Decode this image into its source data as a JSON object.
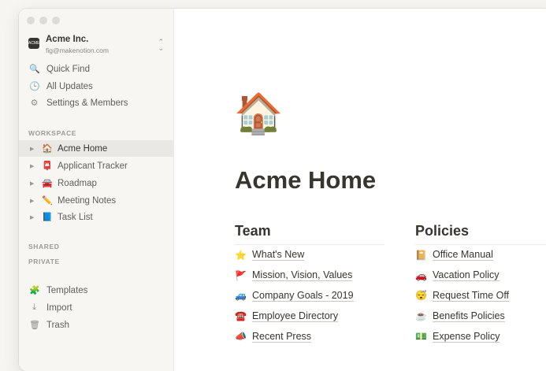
{
  "workspace": {
    "name": "Acme Inc.",
    "email": "fig@makenotion.com",
    "logo_text": "ACME"
  },
  "nav": [
    {
      "icon": "🔍",
      "label": "Quick Find"
    },
    {
      "icon": "🕒",
      "label": "All Updates"
    },
    {
      "icon": "⚙",
      "label": "Settings & Members"
    }
  ],
  "sections": {
    "workspace": "WORKSPACE",
    "shared": "SHARED",
    "private": "PRIVATE"
  },
  "pages": [
    {
      "emoji": "🏠",
      "label": "Acme Home",
      "active": true
    },
    {
      "emoji": "📮",
      "label": "Applicant Tracker"
    },
    {
      "emoji": "🚘",
      "label": "Roadmap"
    },
    {
      "emoji": "✏️",
      "label": "Meeting Notes"
    },
    {
      "emoji": "📘",
      "label": "Task List"
    }
  ],
  "footer_nav": [
    {
      "icon": "🧩",
      "label": "Templates"
    },
    {
      "icon": "⤓",
      "label": "Import"
    },
    {
      "icon": "🗑",
      "label": "Trash"
    }
  ],
  "page": {
    "icon": "🏠",
    "title": "Acme Home"
  },
  "team": {
    "heading": "Team",
    "links": [
      {
        "emoji": "⭐",
        "label": "What's New"
      },
      {
        "emoji": "🚩",
        "label": "Mission, Vision, Values"
      },
      {
        "emoji": "🚙",
        "label": "Company Goals - 2019"
      },
      {
        "emoji": "☎️",
        "label": "Employee Directory"
      },
      {
        "emoji": "📣",
        "label": "Recent Press"
      }
    ]
  },
  "policies": {
    "heading": "Policies",
    "links": [
      {
        "emoji": "📔",
        "label": "Office Manual"
      },
      {
        "emoji": "🚗",
        "label": "Vacation Policy"
      },
      {
        "emoji": "😴",
        "label": "Request Time Off"
      },
      {
        "emoji": "☕",
        "label": "Benefits Policies"
      },
      {
        "emoji": "💵",
        "label": "Expense Policy"
      }
    ]
  }
}
